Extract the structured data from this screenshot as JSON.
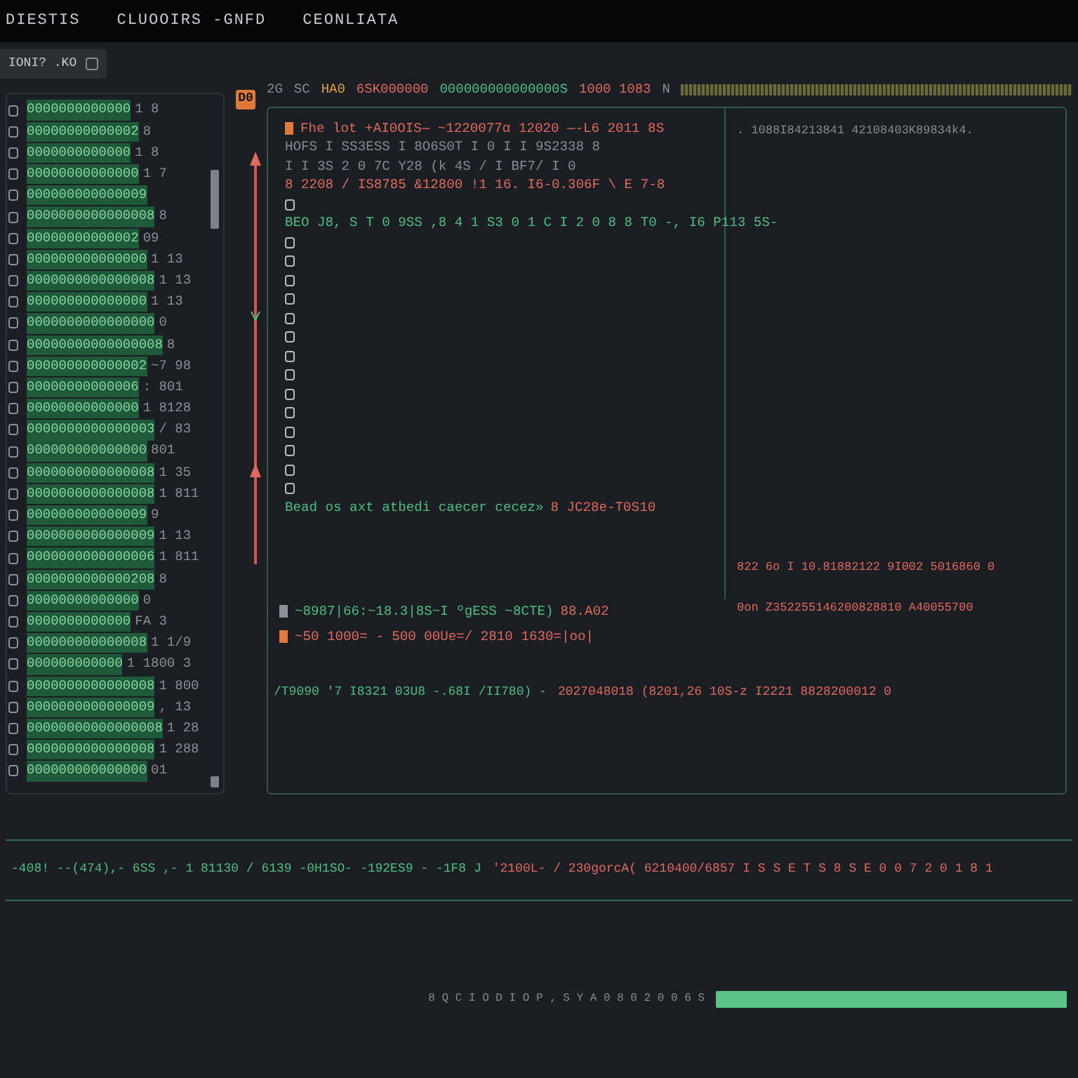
{
  "menu": [
    {
      "label": "DIESTIS"
    },
    {
      "label": "CLUOOIRS -GNFD"
    },
    {
      "label": "CEONLIATA"
    }
  ],
  "tab": {
    "label": "IONI? .KO",
    "selected": true
  },
  "list": {
    "items": [
      {
        "text": "0000000000000",
        "suffix": "1 8"
      },
      {
        "text": "00000000000002",
        "suffix": "8"
      },
      {
        "text": "0000000000000",
        "suffix": "1 8"
      },
      {
        "text": "00000000000000",
        "suffix": "1 7"
      },
      {
        "text": "000000000000009"
      },
      {
        "text": "0000000000000008",
        "suffix": "8"
      },
      {
        "text": "00000000000002",
        "suffix": "09"
      },
      {
        "text": "000000000000000",
        "suffix": "1 13"
      },
      {
        "text": "0000000000000008",
        "suffix": "1 13"
      },
      {
        "text": "000000000000000",
        "suffix": "1 13"
      },
      {
        "text": "0000000000000000",
        "suffix": "0"
      },
      {
        "text": "00000000000000008",
        "suffix": "8"
      },
      {
        "text": "000000000000002",
        "suffix": "~7 98"
      },
      {
        "text": "00000000000006",
        "suffix": ": 801"
      },
      {
        "text": "00000000000000",
        "suffix": "1 8128"
      },
      {
        "text": "0000000000000003",
        "suffix": "/ 83"
      },
      {
        "text": "000000000000000",
        "suffix": "801"
      },
      {
        "text": "0000000000000008",
        "suffix": "1 35"
      },
      {
        "text": "0000000000000008",
        "suffix": "1 811"
      },
      {
        "text": "000000000000009",
        "suffix": "9"
      },
      {
        "text": "0000000000000009",
        "suffix": "1 13"
      },
      {
        "text": "0000000000000006",
        "suffix": "1 811"
      },
      {
        "text": "0000000000000208",
        "suffix": "8"
      },
      {
        "text": "00000000000000",
        "suffix": "0"
      },
      {
        "text": "0000000000000",
        "suffix": "FA 3"
      },
      {
        "text": "000000000000008",
        "suffix": "1 1/9"
      },
      {
        "text": "000000000000",
        "suffix": "1 1800 3"
      },
      {
        "text": "0000000000000008",
        "suffix": "1 800"
      },
      {
        "text": "0000000000000009",
        "suffix": ", 13"
      },
      {
        "text": "00000000000000008",
        "suffix": "1 28"
      },
      {
        "text": "0000000000000008",
        "suffix": "1 288"
      },
      {
        "text": "000000000000000",
        "suffix": "01"
      }
    ]
  },
  "gutter": {
    "badge": "D0"
  },
  "header": [
    {
      "text": "2G",
      "kind": "muted"
    },
    {
      "text": "SC",
      "kind": "muted"
    },
    {
      "text": "HA0",
      "kind": "warning"
    },
    {
      "text": "6SK000000",
      "kind": "error"
    },
    {
      "text": "000000000000000S",
      "kind": "success"
    },
    {
      "text": "1000 1083",
      "kind": "error"
    },
    {
      "text": "N",
      "kind": "muted"
    }
  ],
  "editor": {
    "lines": [
      {
        "kind": "text",
        "color": "#e07a3a",
        "segments": [
          {
            "text": "Fhe lot +AI0OIS— ~1220077α 12020 —-L6 2011 8S",
            "kind": "error"
          }
        ]
      },
      {
        "kind": "text",
        "segments": [
          {
            "text": "HOFS I SS3ESS I 8O6S0T I 0 I I 9S2338 8",
            "kind": "muted"
          }
        ]
      },
      {
        "kind": "text",
        "segments": [
          {
            "text": "I I 3S 2 0 7C Y28 (k 4S / I BF7/ I 0",
            "kind": "muted"
          }
        ]
      },
      {
        "kind": "text",
        "segments": [
          {
            "text": "8 2208 / IS8785 &12800 !1 16. I6-0.306F \\ E 7-8",
            "kind": "error"
          }
        ]
      },
      {
        "kind": "box"
      },
      {
        "kind": "text",
        "segments": [
          {
            "text": "BEO J8, S T 0 9SS ,8 4 1 S3 0 1 C I 2 0 8 8 T0 -, I6 P113 5S-",
            "kind": "success"
          }
        ]
      },
      {
        "kind": "box"
      },
      {
        "kind": "box"
      },
      {
        "kind": "box"
      },
      {
        "kind": "box"
      },
      {
        "kind": "box"
      },
      {
        "kind": "box"
      },
      {
        "kind": "box"
      },
      {
        "kind": "box"
      },
      {
        "kind": "box"
      },
      {
        "kind": "box"
      },
      {
        "kind": "box"
      },
      {
        "kind": "box"
      },
      {
        "kind": "box"
      },
      {
        "kind": "box"
      },
      {
        "kind": "text",
        "segments": [
          {
            "text": "Bead os axt atbedi caecer cecez»",
            "kind": "success"
          },
          {
            "text": "8 JC28e-T0S10",
            "kind": "error"
          }
        ]
      }
    ]
  },
  "right": {
    "top_line": ". 1088I84213841 42108403K89834k4.",
    "mid_line": "822 6o I 10.81882122 9I002 5016860 0",
    "low_line": "0on Z352255146200828810 A40055700"
  },
  "log": {
    "lines": [
      {
        "color": "#8a9096",
        "segments": [
          {
            "text": "~8987|66:~18.3|8S~I ºgESS ~8CTE)",
            "kind": "success"
          },
          {
            "text": "88.A02",
            "kind": "error"
          }
        ]
      },
      {
        "color": "#e07a3a",
        "segments": [
          {
            "text": "~50 1000= - 500 00Ue=/ 2810 1630=|oo|",
            "kind": "error"
          }
        ]
      }
    ]
  },
  "wide_line": [
    {
      "text": "/T9090 '7 I8321 03U8 -.68I /II780) -",
      "kind": "success"
    },
    {
      "text": "2027048018 (8201,26 10S-z I2221 8828200012 0",
      "kind": "error"
    }
  ],
  "status_line": [
    {
      "text": "-408! --(474),- 6SS ,- 1 81130 / 6139 -0H1SO- -192ES9 - -1F8 J",
      "kind": "success"
    },
    {
      "text": "'2100L- / 230gorcA( 6210400/6857 I S S E T S 8 S E 0 0 7 2 0 1 8 1",
      "kind": "error"
    }
  ],
  "lower": {
    "line": "8 Q C I O D I O P , S Y A 0 8 0 2 0 0 6 S",
    "level": 1
  }
}
